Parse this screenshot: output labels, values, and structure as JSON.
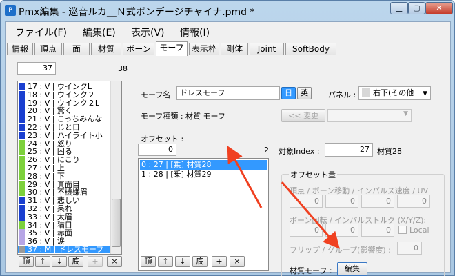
{
  "window": {
    "title": "Pmx編集 - 巡音ルカ＿Ｎ式ボンデージチャイナ.pmd *",
    "min_label": "▁",
    "max_label": "▢",
    "close_label": "✕"
  },
  "menu": [
    "ファイル(F)",
    "編集(E)",
    "表示(V)",
    "情報(I)"
  ],
  "tabs": [
    "情報",
    "頂点",
    "面",
    "材質",
    "ボーン",
    "モーフ",
    "表示枠",
    "剛体",
    "Joint",
    "SoftBody"
  ],
  "active_tab": "モーフ",
  "morph_list": {
    "search_value": "37",
    "count": "38",
    "rows": [
      {
        "text": "17 : V | ウインクL",
        "color": "#1a3fd0"
      },
      {
        "text": "18 : V | ウインク２",
        "color": "#1a3fd0"
      },
      {
        "text": "19 : V | ウインク２L",
        "color": "#1a3fd0"
      },
      {
        "text": "20 : V | 驚く",
        "color": "#1a3fd0"
      },
      {
        "text": "21 : V | こっちみんな",
        "color": "#1a3fd0"
      },
      {
        "text": "22 : V | じと目",
        "color": "#1a3fd0"
      },
      {
        "text": "23 : V | ハイライト小",
        "color": "#1a3fd0"
      },
      {
        "text": "24 : V | 怒り",
        "color": "#7dd13c"
      },
      {
        "text": "25 : V | 困る",
        "color": "#7dd13c"
      },
      {
        "text": "26 : V | にこり",
        "color": "#7dd13c"
      },
      {
        "text": "27 : V | 上",
        "color": "#7dd13c"
      },
      {
        "text": "28 : V | 下",
        "color": "#7dd13c"
      },
      {
        "text": "29 : V | 真面目",
        "color": "#7dd13c"
      },
      {
        "text": "30 : V | 不機嫌眉",
        "color": "#7dd13c"
      },
      {
        "text": "31 : V | 悲しい",
        "color": "#1a3fd0"
      },
      {
        "text": "32 : V | 呆れ",
        "color": "#1a3fd0"
      },
      {
        "text": "33 : V | 太眉",
        "color": "#1a3fd0"
      },
      {
        "text": "34 : V | 猫目",
        "color": "#7dd13c"
      },
      {
        "text": "35 : V | 赤面",
        "color": "#b7a6e6"
      },
      {
        "text": "36 : V | 涙",
        "color": "#b7a6e6"
      },
      {
        "text": "37 : M | ドレスモーフ",
        "color": "#9a9a9a",
        "selected": true
      }
    ],
    "buttons": [
      "頂",
      "↑",
      "↓",
      "底",
      "+",
      "×"
    ]
  },
  "morph_name": {
    "label": "モーフ名",
    "value": "ドレスモーフ",
    "jp_button": "日",
    "en_button": "英",
    "panel_label": "パネル :",
    "panel_value": "右下(その他"
  },
  "morph_type": {
    "label": "モーフ種類 : 材質 モーフ",
    "change_button": "<< 変更"
  },
  "offset": {
    "label": "オフセット :",
    "index_value": "0",
    "count": "2",
    "rows": [
      {
        "text": "0 : 27 | [乗] 材質28",
        "selected": true
      },
      {
        "text": "1 : 28 | [乗] 材質29",
        "selected": false
      }
    ],
    "buttons": [
      "頂",
      "↑",
      "↓",
      "底",
      "+",
      "×"
    ]
  },
  "target": {
    "label": "対象Index :",
    "value": "27",
    "name": "材質28"
  },
  "offset_amount": {
    "group_label": "オフセット量",
    "vertex_bone_label": "頂点 / ボーン移動 / インパルス速度 / UV",
    "vertex_values": [
      "0",
      "0",
      "0",
      "0"
    ],
    "bone_rotate_label": "ボーン回転 / インパルストルク (X/Y/Z):",
    "rotate_values": [
      "0",
      "0",
      "0"
    ],
    "local_label": "Local",
    "flip_label": "フリップ / グループ(影響度) :",
    "flip_value": "0",
    "material_morph_label": "材質モーフ :",
    "edit_button": "編集"
  }
}
